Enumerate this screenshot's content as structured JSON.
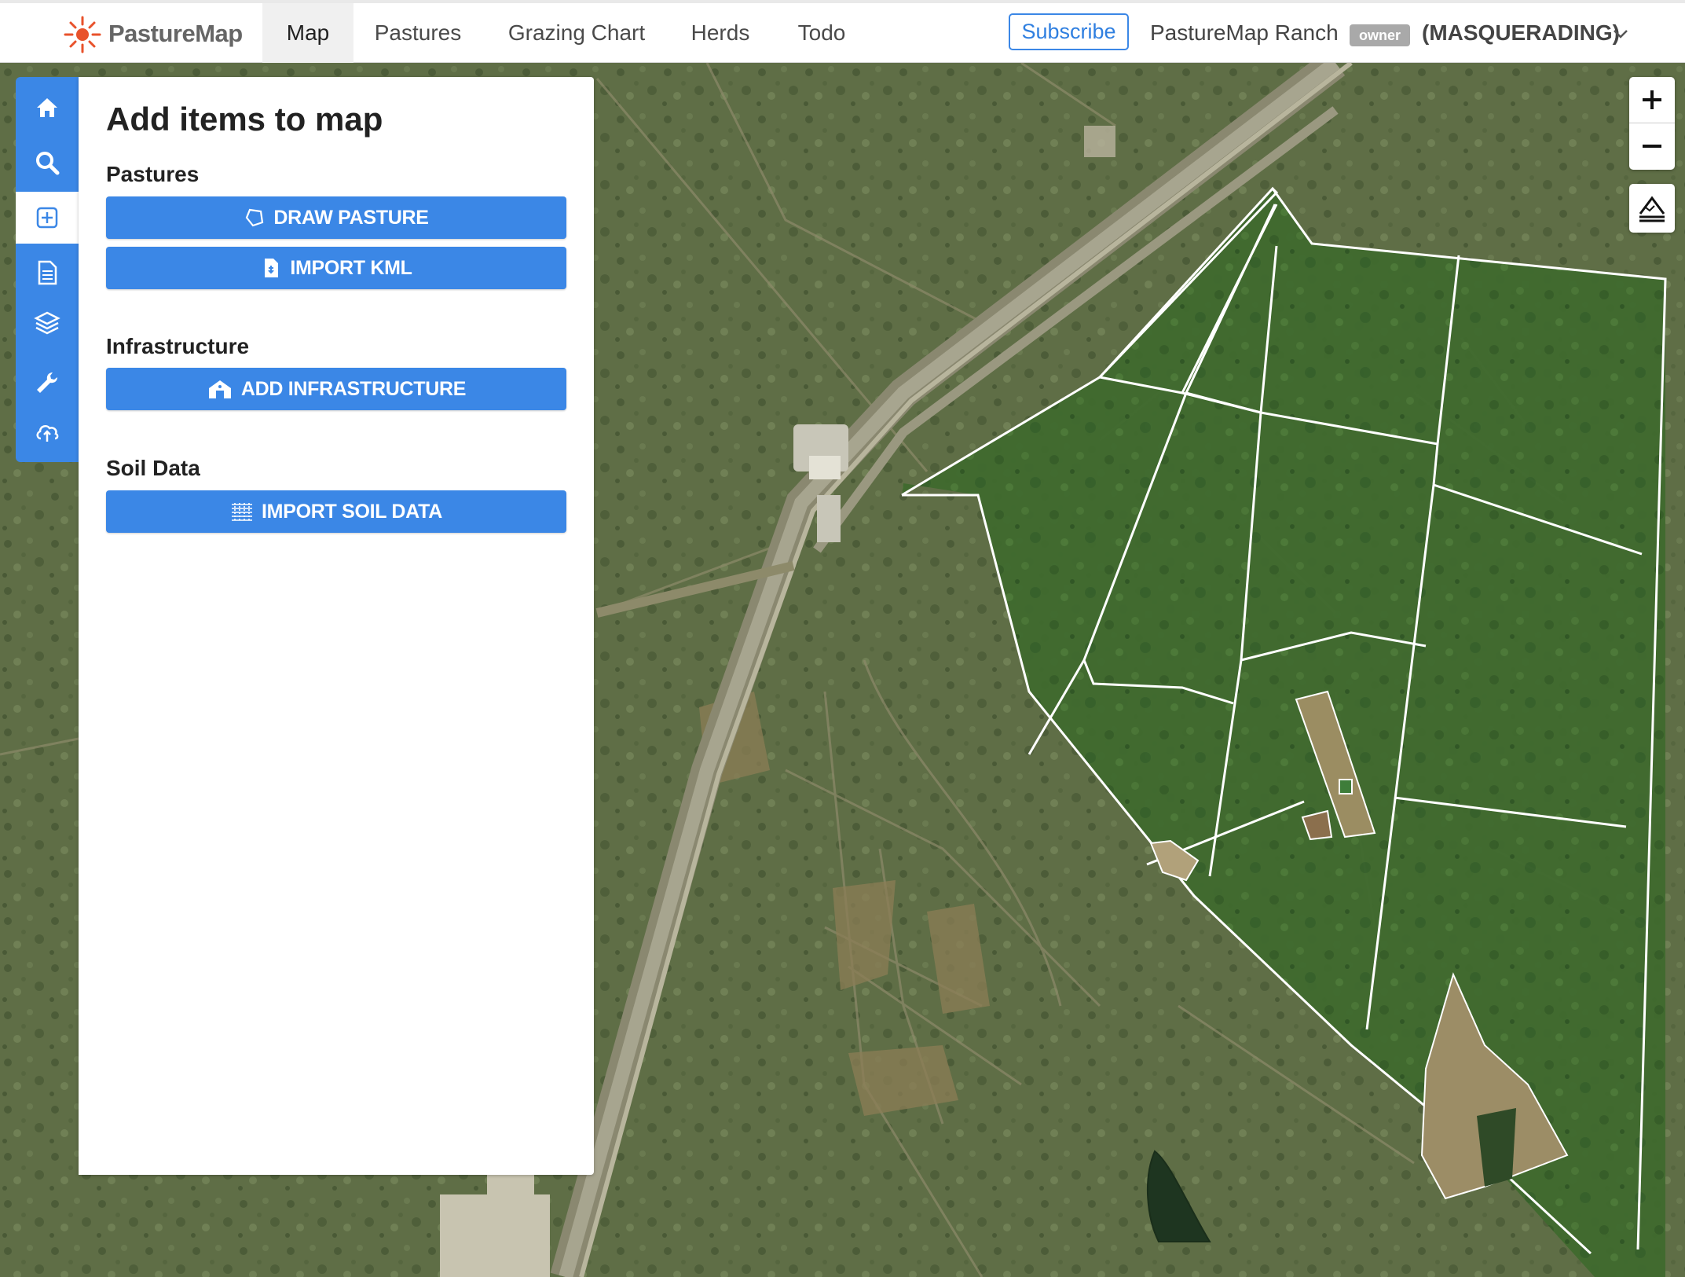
{
  "header": {
    "brand": "PastureMap",
    "tabs": [
      {
        "label": "Map",
        "active": true
      },
      {
        "label": "Pastures",
        "active": false
      },
      {
        "label": "Grazing Chart",
        "active": false
      },
      {
        "label": "Herds",
        "active": false
      },
      {
        "label": "Todo",
        "active": false
      }
    ],
    "subscribe_label": "Subscribe",
    "ranch_name": "PastureMap Ranch",
    "role_badge": "owner",
    "masquerade_label": "(MASQUERADING)"
  },
  "rail": {
    "items": [
      {
        "icon": "home-icon",
        "active": false
      },
      {
        "icon": "search-icon",
        "active": false
      },
      {
        "icon": "add-icon",
        "active": true
      },
      {
        "icon": "document-icon",
        "active": false
      },
      {
        "icon": "layers-icon",
        "active": false
      },
      {
        "icon": "wrench-icon",
        "active": false
      },
      {
        "icon": "cloud-upload-icon",
        "active": false
      }
    ]
  },
  "panel": {
    "title": "Add items to map",
    "sections": {
      "pastures": {
        "heading": "Pastures",
        "draw_label": "DRAW PASTURE",
        "import_label": "IMPORT KML"
      },
      "infrastructure": {
        "heading": "Infrastructure",
        "add_label": "ADD INFRASTRUCTURE"
      },
      "soil": {
        "heading": "Soil Data",
        "import_label": "IMPORT SOIL DATA"
      }
    }
  },
  "colors": {
    "accent": "#3b87e6",
    "map_base": "#5f6e46",
    "pasture_green": "#3f6a2e",
    "boundary": "#ffffff"
  }
}
